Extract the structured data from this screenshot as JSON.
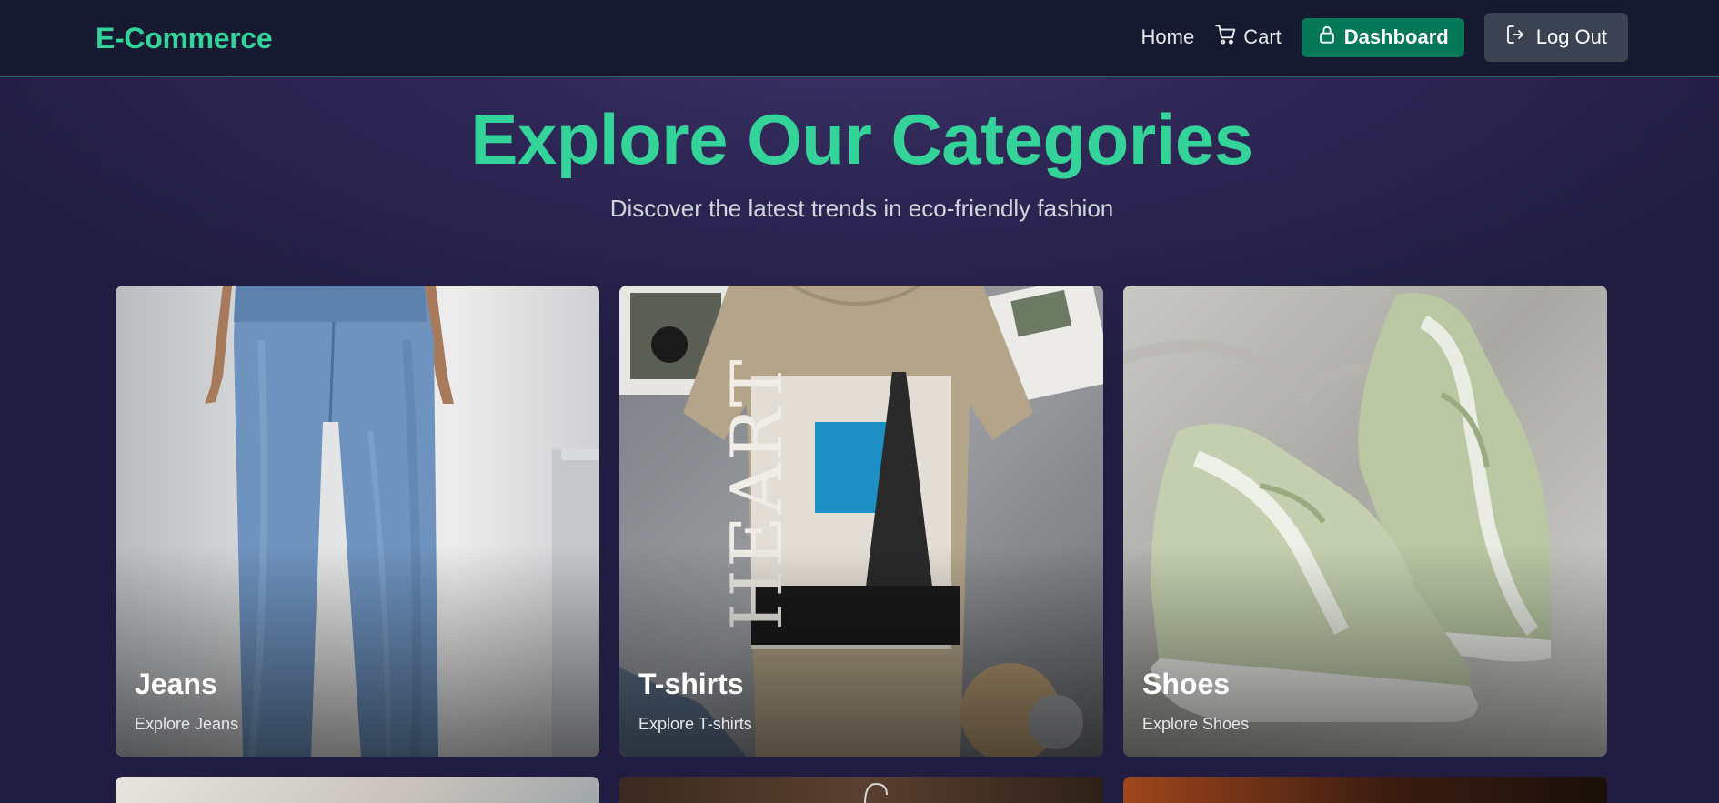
{
  "navbar": {
    "brand": "E-Commerce",
    "links": {
      "home": "Home",
      "cart": "Cart",
      "dashboard": "Dashboard",
      "logout": "Log Out"
    }
  },
  "hero": {
    "title": "Explore Our Categories",
    "subtitle": "Discover the latest trends in eco-friendly fashion"
  },
  "categories": [
    {
      "name": "Jeans",
      "link": "Explore Jeans"
    },
    {
      "name": "T-shirts",
      "link": "Explore T-shirts"
    },
    {
      "name": "Shoes",
      "link": "Explore Shoes"
    }
  ],
  "colors": {
    "accent": "#34d399",
    "dashboard_button": "#047857",
    "logout_button": "#3b4252",
    "navbar_bg": "#151a30",
    "page_bg": "#2e2655"
  }
}
